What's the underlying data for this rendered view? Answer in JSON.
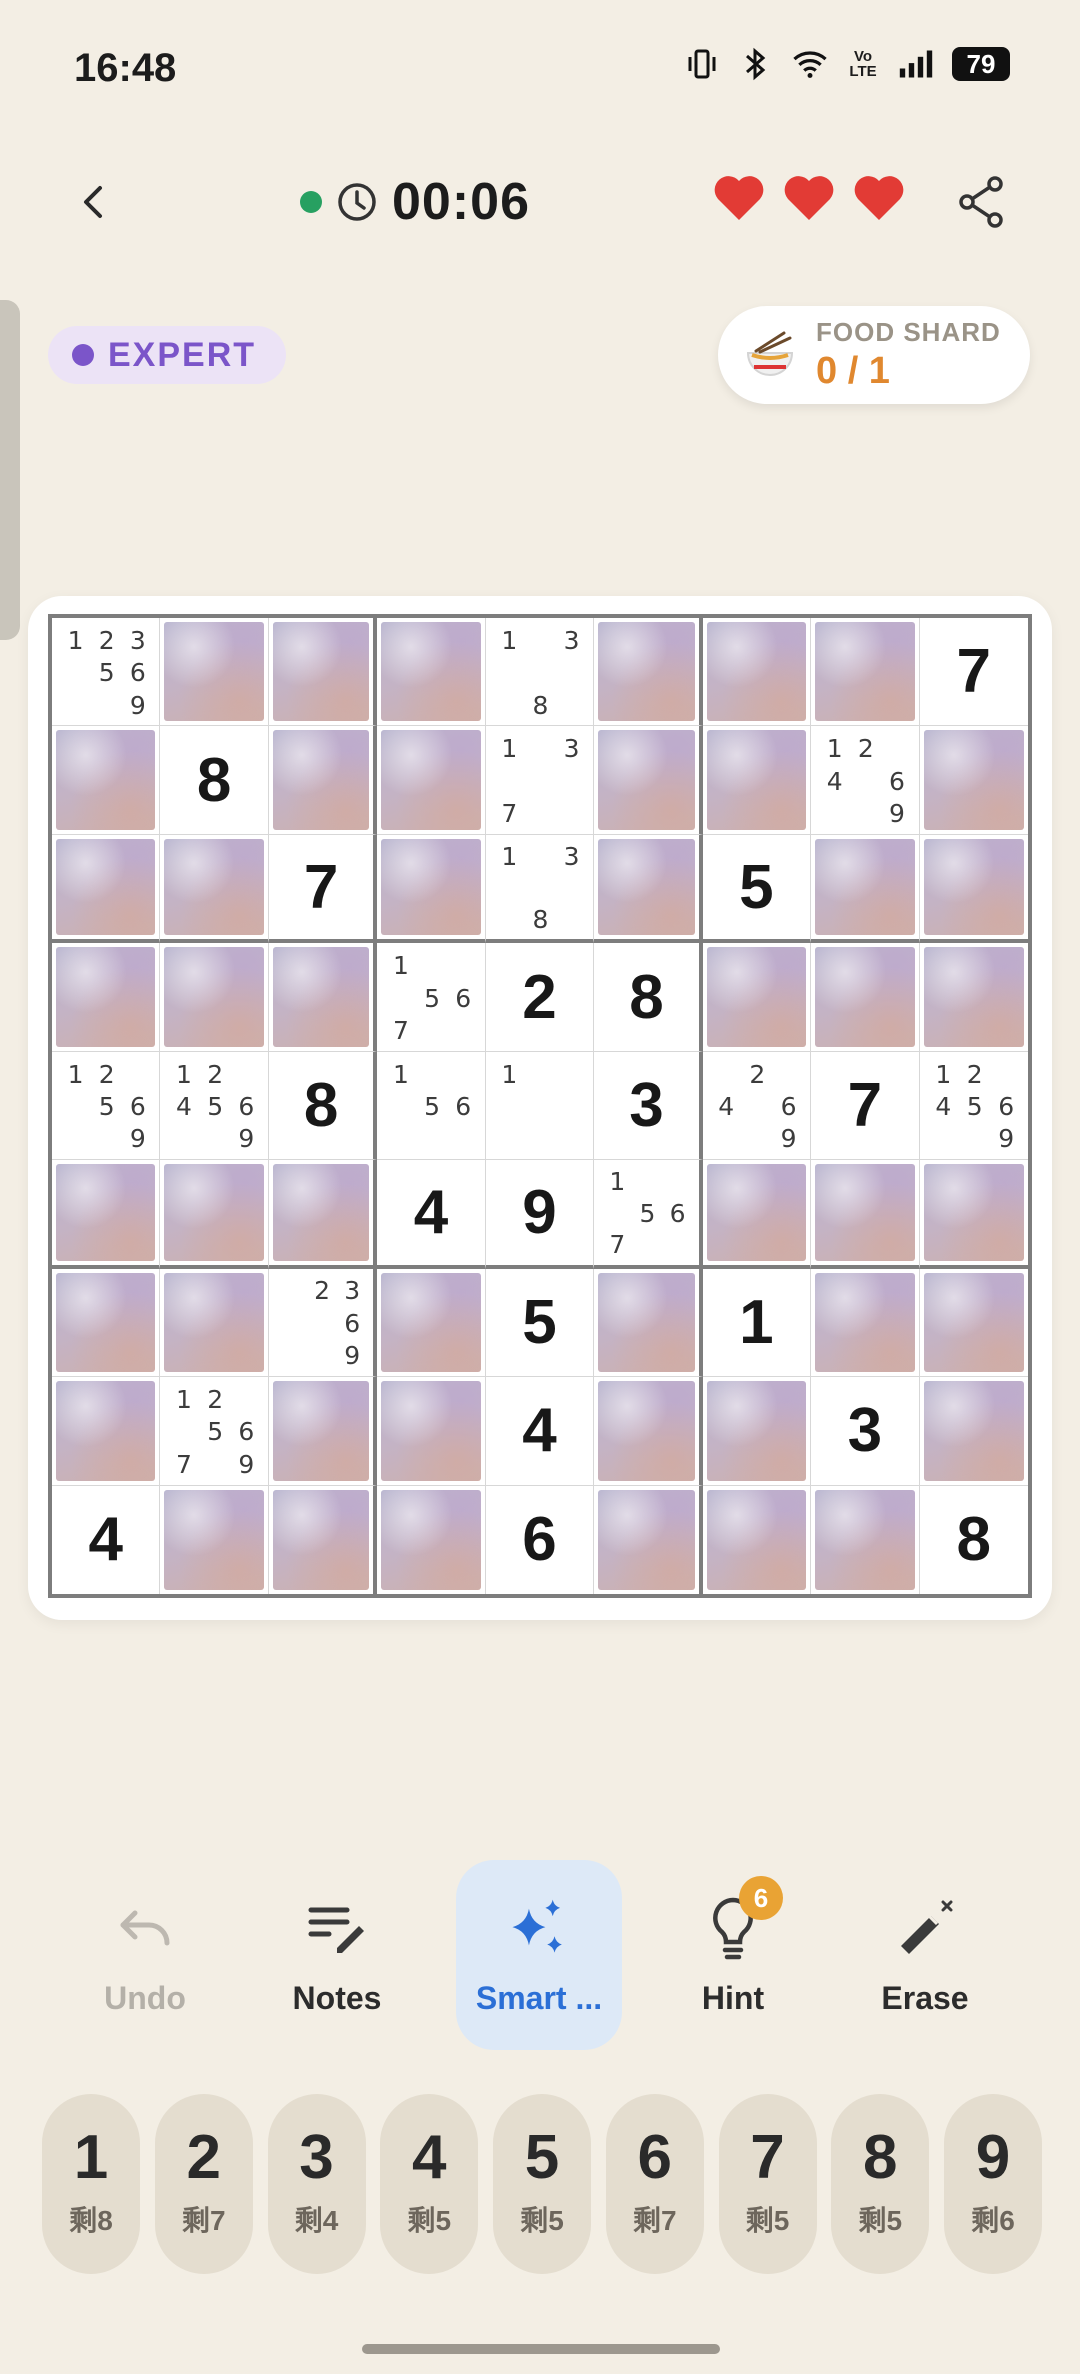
{
  "status_bar": {
    "time": "16:48",
    "network_label": "Vo LTE",
    "battery": "79"
  },
  "header": {
    "timer": "00:06",
    "lives": 3
  },
  "difficulty": {
    "label": "EXPERT",
    "color": "#7b55c9"
  },
  "shard": {
    "label": "FOOD SHARD",
    "count": "0 / 1",
    "count_color": "#e0882f"
  },
  "board": [
    [
      {
        "n": [
          1,
          2,
          3,
          5,
          6,
          9
        ]
      },
      "f",
      "f",
      "f",
      {
        "n": [
          1,
          3,
          8
        ]
      },
      "f",
      "f",
      "f",
      {
        "v": "7"
      }
    ],
    [
      "f",
      {
        "v": "8"
      },
      "f",
      "f",
      {
        "n": [
          1,
          3,
          7
        ]
      },
      "f",
      "f",
      {
        "n": [
          1,
          2,
          4,
          6,
          9
        ]
      },
      "f"
    ],
    [
      "f",
      "f",
      {
        "v": "7"
      },
      "f",
      {
        "n": [
          1,
          3,
          8
        ]
      },
      "f",
      {
        "v": "5"
      },
      "f",
      "f"
    ],
    [
      "f",
      "f",
      "f",
      {
        "n": [
          1,
          5,
          6,
          7
        ]
      },
      {
        "v": "2"
      },
      {
        "v": "8"
      },
      "f",
      "f",
      "f"
    ],
    [
      {
        "n": [
          1,
          2,
          5,
          6,
          9
        ]
      },
      {
        "n": [
          1,
          2,
          4,
          5,
          6,
          9
        ]
      },
      {
        "v": "8"
      },
      {
        "n": [
          1,
          5,
          6
        ]
      },
      {
        "n": [
          1
        ]
      },
      {
        "v": "3"
      },
      {
        "n": [
          2,
          4,
          6,
          9
        ]
      },
      {
        "v": "7"
      },
      {
        "n": [
          1,
          2,
          4,
          5,
          6,
          9
        ]
      }
    ],
    [
      "f",
      "f",
      "f",
      {
        "v": "4"
      },
      {
        "v": "9"
      },
      {
        "n": [
          1,
          5,
          6,
          7
        ]
      },
      "f",
      "f",
      "f"
    ],
    [
      "f",
      "f",
      {
        "n": [
          2,
          3,
          6,
          9
        ]
      },
      "f",
      {
        "v": "5"
      },
      "f",
      {
        "v": "1"
      },
      "f",
      "f"
    ],
    [
      "f",
      {
        "n": [
          1,
          2,
          5,
          6,
          7,
          9
        ]
      },
      "f",
      "f",
      {
        "v": "4"
      },
      "f",
      "f",
      {
        "v": "3"
      },
      "f"
    ],
    [
      {
        "v": "4"
      },
      "f",
      "f",
      "f",
      {
        "v": "6"
      },
      "f",
      "f",
      "f",
      {
        "v": "8"
      }
    ]
  ],
  "tools": {
    "undo": "Undo",
    "notes": "Notes",
    "smart": "Smart ...",
    "hint": "Hint",
    "hint_count": "6",
    "erase": "Erase"
  },
  "numpad": [
    {
      "num": "1",
      "remaining": "剩8"
    },
    {
      "num": "2",
      "remaining": "剩7"
    },
    {
      "num": "3",
      "remaining": "剩4"
    },
    {
      "num": "4",
      "remaining": "剩5"
    },
    {
      "num": "5",
      "remaining": "剩5"
    },
    {
      "num": "6",
      "remaining": "剩7"
    },
    {
      "num": "7",
      "remaining": "剩5"
    },
    {
      "num": "8",
      "remaining": "剩5"
    },
    {
      "num": "9",
      "remaining": "剩6"
    }
  ],
  "colors": {
    "background": "#f3eee4",
    "heart": "#e23b35",
    "live_dot": "#27a061",
    "smart_accent": "#2b6fd6",
    "hint_badge": "#e9a334"
  }
}
